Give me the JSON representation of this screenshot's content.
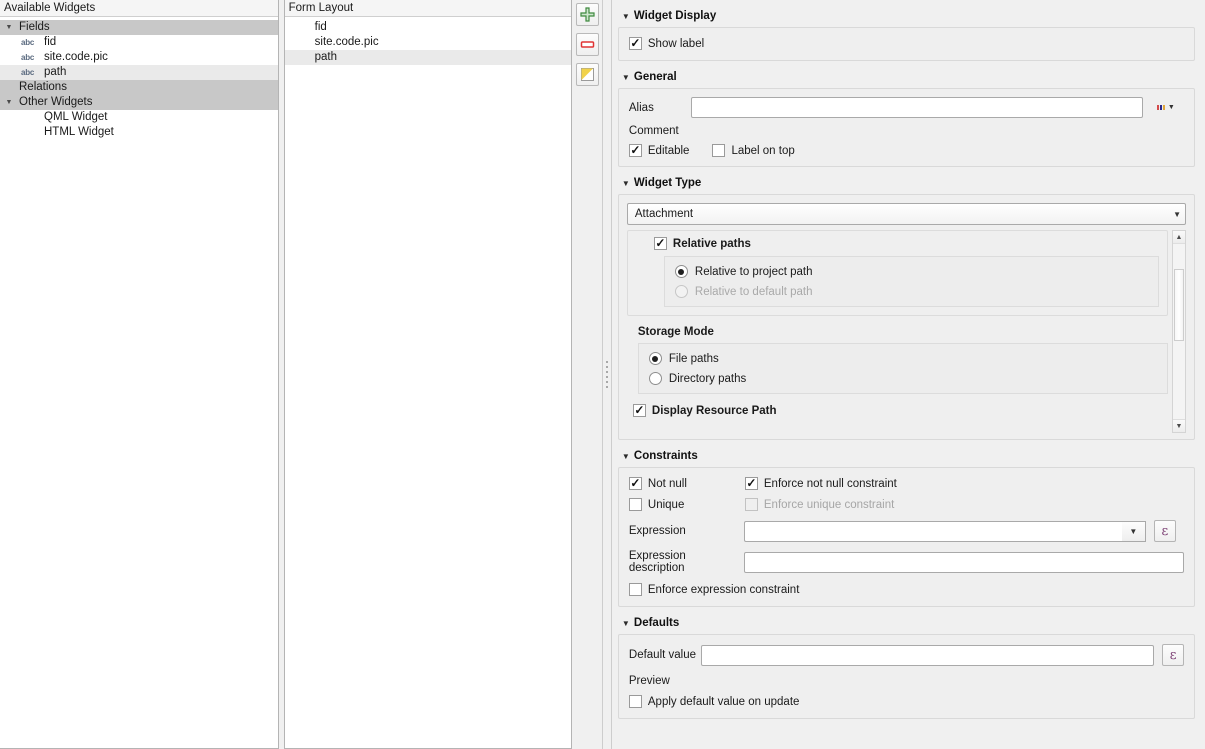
{
  "available_widgets": {
    "header": "Available Widgets",
    "items": [
      {
        "label": "Fields",
        "kind": "group",
        "expanded": true,
        "selected": false
      },
      {
        "label": "fid",
        "kind": "field",
        "icon": "abc",
        "selected": false
      },
      {
        "label": "site.code.pic",
        "kind": "field",
        "icon": "abc",
        "selected": false
      },
      {
        "label": "path",
        "kind": "field",
        "icon": "abc",
        "selected": true
      },
      {
        "label": "Relations",
        "kind": "group",
        "expanded": false,
        "selected": false
      },
      {
        "label": "Other Widgets",
        "kind": "group",
        "expanded": true,
        "selected": false
      },
      {
        "label": "QML Widget",
        "kind": "widget",
        "selected": false
      },
      {
        "label": "HTML Widget",
        "kind": "widget",
        "selected": false
      }
    ]
  },
  "form_layout": {
    "header": "Form Layout",
    "items": [
      {
        "label": "fid",
        "selected": false
      },
      {
        "label": "site.code.pic",
        "selected": false
      },
      {
        "label": "path",
        "selected": true
      }
    ]
  },
  "toolbar": {
    "buttons": [
      {
        "name": "add-item-button",
        "icon": "plus-icon",
        "color": "#3f8a3f"
      },
      {
        "name": "remove-item-button",
        "icon": "minus-icon",
        "color": "#e03434"
      },
      {
        "name": "new-container-button",
        "icon": "container-icon",
        "color": "#f1d24a"
      }
    ]
  },
  "widget_display": {
    "title": "Widget Display",
    "show_label": {
      "label": "Show label",
      "checked": true
    }
  },
  "general": {
    "title": "General",
    "alias": {
      "label": "Alias",
      "value": "",
      "placeholder": ""
    },
    "comment": {
      "label": "Comment"
    },
    "editable": {
      "label": "Editable",
      "checked": true
    },
    "label_on_top": {
      "label": "Label on top",
      "checked": false
    }
  },
  "widget_type": {
    "title": "Widget Type",
    "selected": "Attachment",
    "relative_paths": {
      "label": "Relative paths",
      "checked": true
    },
    "path_options": [
      {
        "label": "Relative to project path",
        "selected": true,
        "enabled": true
      },
      {
        "label": "Relative to default path",
        "selected": false,
        "enabled": false
      }
    ],
    "storage_mode": {
      "title": "Storage Mode"
    },
    "storage_options": [
      {
        "label": "File paths",
        "selected": true,
        "enabled": true
      },
      {
        "label": "Directory paths",
        "selected": false,
        "enabled": true
      }
    ],
    "display_resource_path": {
      "label": "Display Resource Path",
      "checked": true
    }
  },
  "constraints": {
    "title": "Constraints",
    "not_null": {
      "label": "Not null",
      "checked": true
    },
    "enforce_not_null": {
      "label": "Enforce not null constraint",
      "checked": true,
      "enabled": true
    },
    "unique": {
      "label": "Unique",
      "checked": false
    },
    "enforce_unique": {
      "label": "Enforce unique constraint",
      "checked": false,
      "enabled": false
    },
    "expression": {
      "label": "Expression",
      "value": "",
      "placeholder": ""
    },
    "expression_description": {
      "label": "Expression description",
      "value": "",
      "placeholder": ""
    },
    "enforce_expression": {
      "label": "Enforce expression constraint",
      "checked": false
    }
  },
  "defaults": {
    "title": "Defaults",
    "default_value": {
      "label": "Default value",
      "value": "",
      "placeholder": ""
    },
    "preview": {
      "label": "Preview",
      "value": ""
    },
    "apply_on_update": {
      "label": "Apply default value on update",
      "checked": false
    }
  }
}
